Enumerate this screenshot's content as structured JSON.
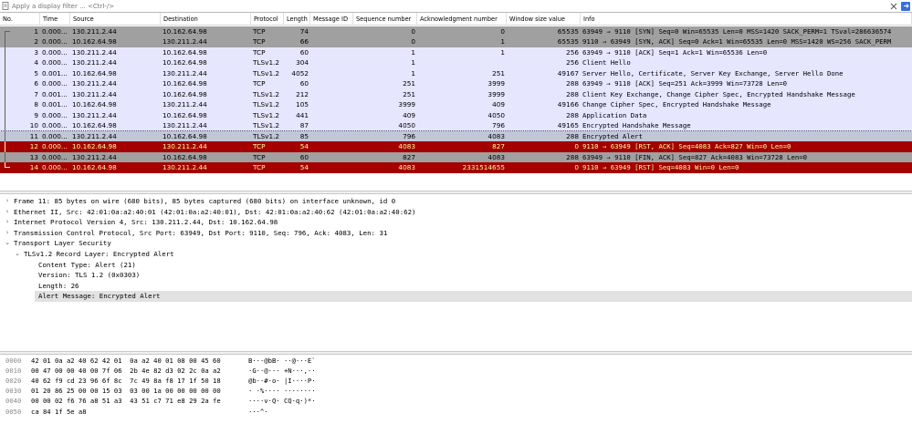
{
  "filter": {
    "placeholder": "Apply a display filter ... <Ctrl-/>",
    "bookmark_icon": "bookmark-icon",
    "clear_icon": "close-icon",
    "apply_icon": "arrow-right-icon"
  },
  "columns": [
    "No.",
    "Time",
    "Source",
    "Destination",
    "Protocol",
    "Length",
    "Message ID",
    "Sequence number",
    "Acknowledgment number",
    "Window size value",
    "Info"
  ],
  "colors": {
    "tcp_gray": "#a0a0a0",
    "lavender": "#e7e6ff",
    "selected": "#c2c7d7",
    "rst_red": "#a40000",
    "rst_text": "#fffc9c",
    "detail_highlight": "#e2e2e2"
  },
  "packets": [
    {
      "no": "1",
      "time": "0.000...",
      "src": "130.211.2.44",
      "dst": "10.162.64.98",
      "proto": "TCP",
      "len": "74",
      "msgid": "",
      "seq": "0",
      "ack": "0",
      "win": "65535",
      "info": "63949 → 9110 [SYN] Seq=0 Win=65535 Len=0 MSS=1420 SACK_PERM=1 TSval=286636574",
      "style": "gray"
    },
    {
      "no": "2",
      "time": "0.000...",
      "src": "10.162.64.98",
      "dst": "130.211.2.44",
      "proto": "TCP",
      "len": "66",
      "msgid": "",
      "seq": "0",
      "ack": "1",
      "win": "65535",
      "info": "9110 → 63949 [SYN, ACK] Seq=0 Ack=1 Win=65535 Len=0 MSS=1420 WS=256 SACK_PERM",
      "style": "gray"
    },
    {
      "no": "3",
      "time": "0.000...",
      "src": "130.211.2.44",
      "dst": "10.162.64.98",
      "proto": "TCP",
      "len": "60",
      "msgid": "",
      "seq": "1",
      "ack": "1",
      "win": "256",
      "info": "63949 → 9110 [ACK] Seq=1 Ack=1 Win=65536 Len=0",
      "style": "lavender"
    },
    {
      "no": "4",
      "time": "0.000...",
      "src": "130.211.2.44",
      "dst": "10.162.64.98",
      "proto": "TLSv1.2",
      "len": "304",
      "msgid": "",
      "seq": "1",
      "ack": "",
      "win": "256",
      "info": "Client Hello",
      "style": "lavender"
    },
    {
      "no": "5",
      "time": "0.001...",
      "src": "10.162.64.98",
      "dst": "130.211.2.44",
      "proto": "TLSv1.2",
      "len": "4052",
      "msgid": "",
      "seq": "1",
      "ack": "251",
      "win": "49167",
      "info": "Server Hello, Certificate, Server Key Exchange, Server Hello Done",
      "style": "lavender"
    },
    {
      "no": "6",
      "time": "0.000...",
      "src": "130.211.2.44",
      "dst": "10.162.64.98",
      "proto": "TCP",
      "len": "60",
      "msgid": "",
      "seq": "251",
      "ack": "3999",
      "win": "288",
      "info": "63949 → 9110 [ACK] Seq=251 Ack=3999 Win=73728 Len=0",
      "style": "lavender"
    },
    {
      "no": "7",
      "time": "0.001...",
      "src": "130.211.2.44",
      "dst": "10.162.64.98",
      "proto": "TLSv1.2",
      "len": "212",
      "msgid": "",
      "seq": "251",
      "ack": "3999",
      "win": "288",
      "info": "Client Key Exchange, Change Cipher Spec, Encrypted Handshake Message",
      "style": "lavender"
    },
    {
      "no": "8",
      "time": "0.001...",
      "src": "10.162.64.98",
      "dst": "130.211.2.44",
      "proto": "TLSv1.2",
      "len": "105",
      "msgid": "",
      "seq": "3999",
      "ack": "409",
      "win": "49166",
      "info": "Change Cipher Spec, Encrypted Handshake Message",
      "style": "lavender"
    },
    {
      "no": "9",
      "time": "0.000...",
      "src": "130.211.2.44",
      "dst": "10.162.64.98",
      "proto": "TLSv1.2",
      "len": "441",
      "msgid": "",
      "seq": "409",
      "ack": "4050",
      "win": "288",
      "info": "Application Data",
      "style": "lavender"
    },
    {
      "no": "10",
      "time": "0.000...",
      "src": "10.162.64.98",
      "dst": "130.211.2.44",
      "proto": "TLSv1.2",
      "len": "87",
      "msgid": "",
      "seq": "4050",
      "ack": "796",
      "win": "49165",
      "info": "Encrypted Handshake Message",
      "style": "lavender"
    },
    {
      "no": "11",
      "time": "0.000...",
      "src": "130.211.2.44",
      "dst": "10.162.64.98",
      "proto": "TLSv1.2",
      "len": "85",
      "msgid": "",
      "seq": "796",
      "ack": "4083",
      "win": "288",
      "info": "Encrypted Alert",
      "style": "selected"
    },
    {
      "no": "12",
      "time": "0.000...",
      "src": "10.162.64.98",
      "dst": "130.211.2.44",
      "proto": "TCP",
      "len": "54",
      "msgid": "",
      "seq": "4083",
      "ack": "827",
      "win": "0",
      "info": "9110 → 63949 [RST, ACK] Seq=4083 Ack=827 Win=0 Len=0",
      "style": "red"
    },
    {
      "no": "13",
      "time": "0.000...",
      "src": "130.211.2.44",
      "dst": "10.162.64.98",
      "proto": "TCP",
      "len": "60",
      "msgid": "",
      "seq": "827",
      "ack": "4083",
      "win": "288",
      "info": "63949 → 9110 [FIN, ACK] Seq=827 Ack=4083 Win=73728 Len=0",
      "style": "gray"
    },
    {
      "no": "14",
      "time": "0.000...",
      "src": "10.162.64.98",
      "dst": "130.211.2.44",
      "proto": "TCP",
      "len": "54",
      "msgid": "",
      "seq": "4083",
      "ack": "2331514655",
      "win": "0",
      "info": "9110 → 63949 [RST] Seq=4083 Win=0 Len=0",
      "style": "red"
    }
  ],
  "details": [
    {
      "text": "Frame 11: 85 bytes on wire (680 bits), 85 bytes captured (680 bits) on interface unknown, id 0",
      "level": 0,
      "arrow": "›"
    },
    {
      "text": "Ethernet II, Src: 42:01:0a:a2:40:01 (42:01:0a:a2:40:01), Dst: 42:01:0a:a2:40:62 (42:01:0a:a2:40:62)",
      "level": 0,
      "arrow": "›"
    },
    {
      "text": "Internet Protocol Version 4, Src: 130.211.2.44, Dst: 10.162.64.98",
      "level": 0,
      "arrow": "›"
    },
    {
      "text": "Transmission Control Protocol, Src Port: 63949, Dst Port: 9110, Seq: 796, Ack: 4083, Len: 31",
      "level": 0,
      "arrow": "›"
    },
    {
      "text": "Transport Layer Security",
      "level": 0,
      "arrow": "⌄"
    },
    {
      "text": "TLSv1.2 Record Layer: Encrypted Alert",
      "level": 1,
      "arrow": "⌄"
    },
    {
      "text": "Content Type: Alert (21)",
      "level": 2,
      "arrow": ""
    },
    {
      "text": "Version: TLS 1.2 (0x0303)",
      "level": 2,
      "arrow": ""
    },
    {
      "text": "Length: 26",
      "level": 2,
      "arrow": ""
    },
    {
      "text": "Alert Message: Encrypted Alert",
      "level": 2,
      "arrow": "",
      "highlight": true
    }
  ],
  "bytes": [
    {
      "off": "0000",
      "hex": "42 01 0a a2 40 62 42 01  0a a2 40 01 08 00 45 60",
      "ascii": "B···@bB· ··@···E`"
    },
    {
      "off": "0010",
      "hex": "00 47 00 00 40 00 7f 06  2b 4e 82 d3 02 2c 0a a2",
      "ascii": "·G··@··· +N···,··"
    },
    {
      "off": "0020",
      "hex": "40 62 f9 cd 23 96 6f 8c  7c 49 8a f8 17 1f 50 18",
      "ascii": "@b··#·o· |I····P·"
    },
    {
      "off": "0030",
      "hex": "01 20 86 25 00 00 15 03  03 00 1a 00 00 00 00 00",
      "ascii": "· ·%···· ········"
    },
    {
      "off": "0040",
      "hex": "00 00 02 f6 76 a8 51 a3  43 51 c7 71 e8 29 2a fe",
      "ascii": "····v·Q· CQ·q·)*·"
    },
    {
      "off": "0050",
      "hex": "ca 84 1f 5e a8",
      "ascii": "···^·"
    }
  ]
}
